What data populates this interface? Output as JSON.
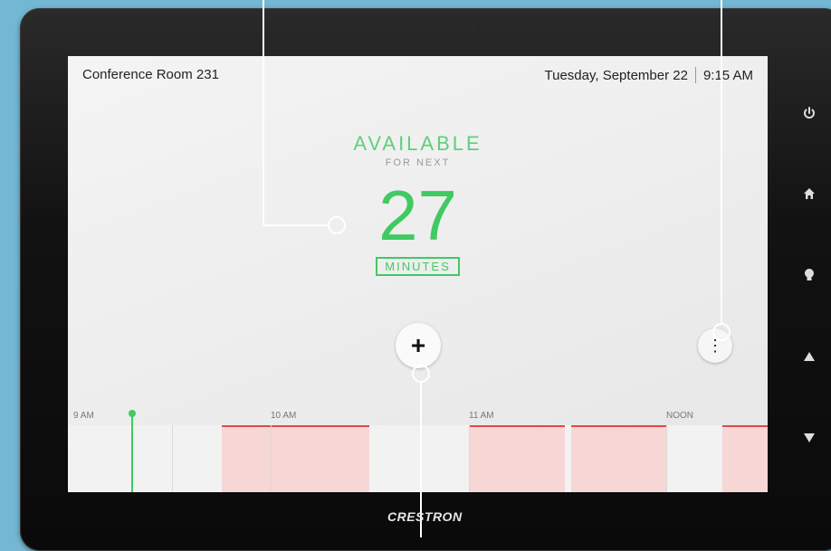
{
  "header": {
    "room_name": "Conference Room 231",
    "date": "Tuesday, September 22",
    "time": "9:15 AM"
  },
  "status": {
    "state": "AVAILABLE",
    "subtitle": "FOR NEXT",
    "minutes_value": "27",
    "minutes_label": "MINUTES"
  },
  "actions": {
    "add_icon": "plus-icon",
    "more_icon": "more-vertical-icon"
  },
  "timeline": {
    "labels": [
      "9 AM",
      "10 AM",
      "11 AM",
      "NOON"
    ]
  },
  "hardware_buttons": [
    "power-icon",
    "home-icon",
    "lightbulb-icon",
    "up-arrow-icon",
    "down-arrow-icon"
  ],
  "brand": "CRESTRON",
  "colors": {
    "available_green": "#3fca62",
    "booked_fill": "#f7d6d6",
    "booked_line": "#e04a4a",
    "background": "#74b7d3"
  }
}
